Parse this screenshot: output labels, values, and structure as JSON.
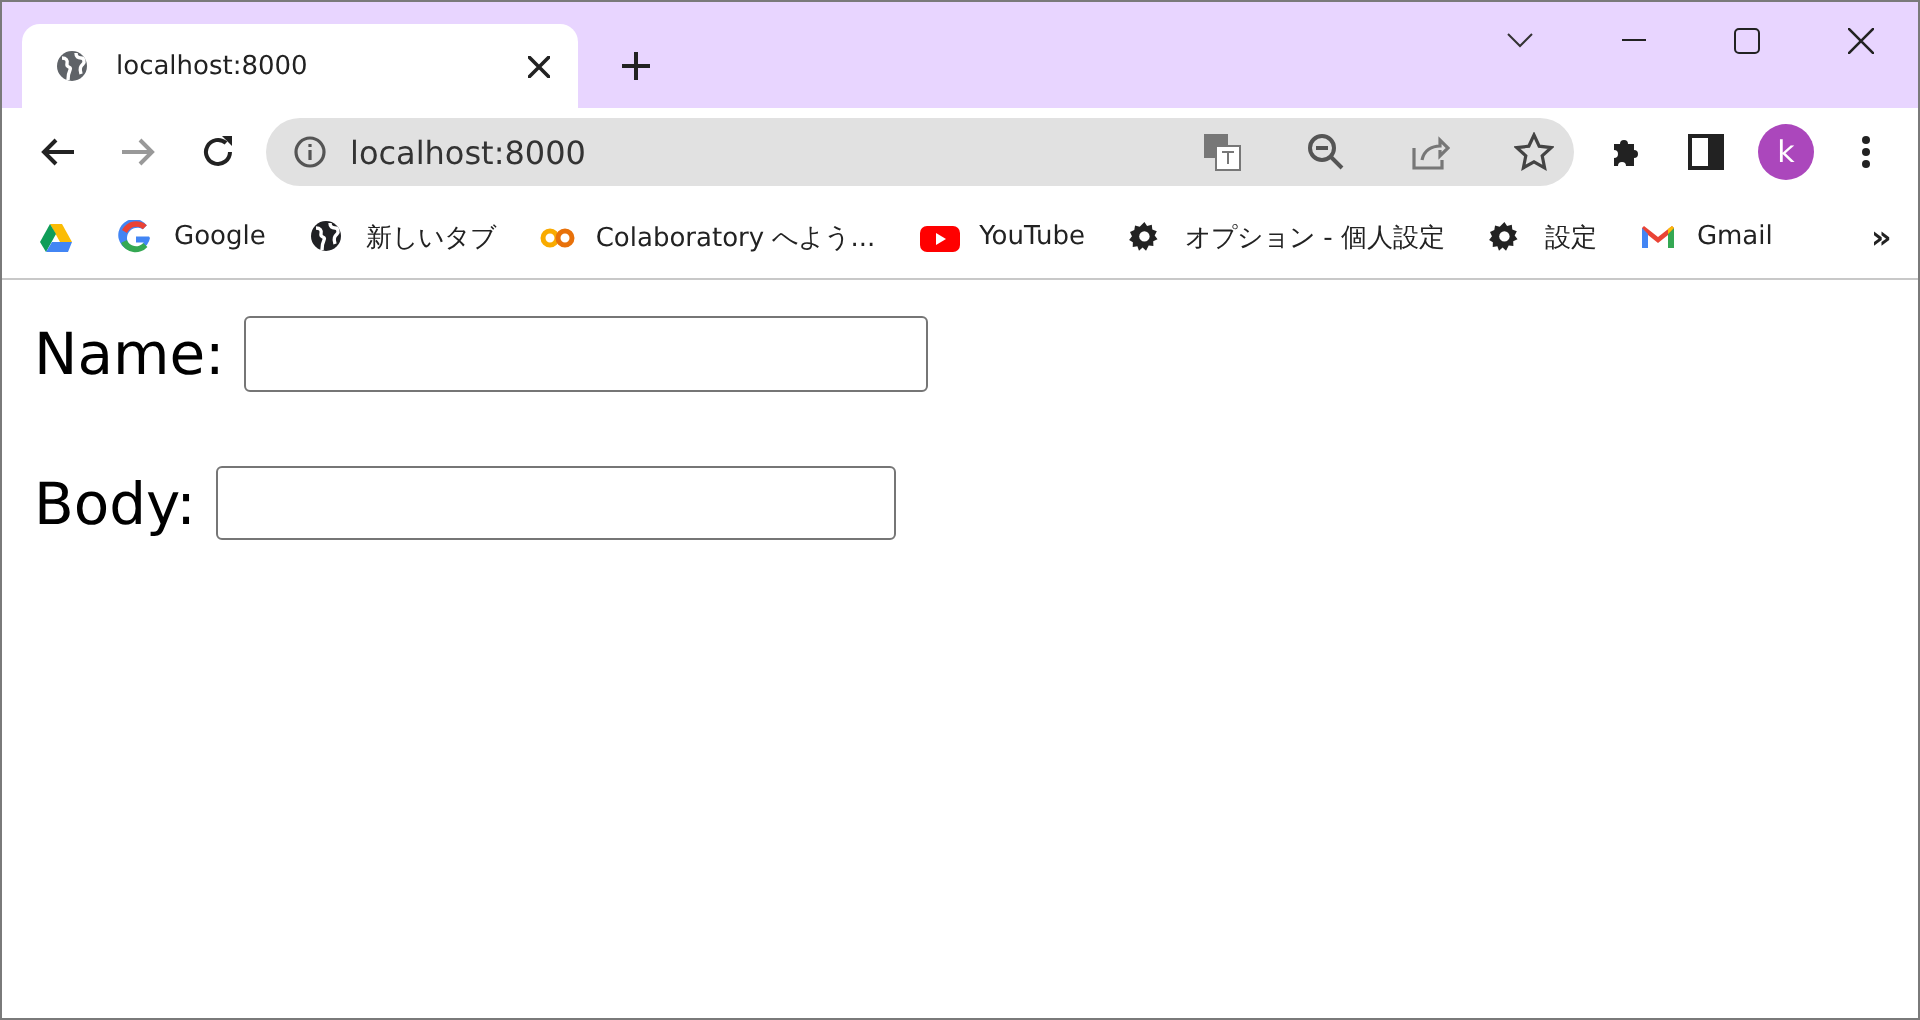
{
  "tabs": [
    {
      "title": "localhost:8000",
      "selected": true
    }
  ],
  "address_bar": {
    "url": "localhost:8000"
  },
  "profile": {
    "initial": "k"
  },
  "bookmarks": [
    {
      "kind": "drive"
    },
    {
      "kind": "google",
      "label": "Google"
    },
    {
      "kind": "globe",
      "label": "新しいタブ"
    },
    {
      "kind": "colab",
      "label": "Colaboratory へよう..."
    },
    {
      "kind": "youtube",
      "label": "YouTube"
    },
    {
      "kind": "gear",
      "label": "オプション - 個人設定"
    },
    {
      "kind": "gear",
      "label": "設定"
    },
    {
      "kind": "gmail",
      "label": "Gmail"
    }
  ],
  "bookmarks_overflow": "»",
  "form": {
    "fields": [
      {
        "label": "Name:"
      },
      {
        "label": "Body:"
      }
    ]
  }
}
